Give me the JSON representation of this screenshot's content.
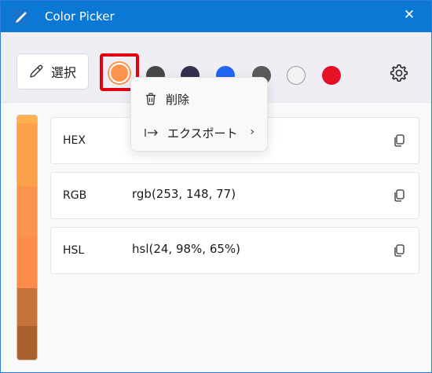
{
  "window": {
    "title": "Color Picker",
    "close_glyph": "✕"
  },
  "toolbar": {
    "select_label": "選択",
    "selected_color": "#fd944d",
    "swatches": [
      "#474747",
      "#34304d",
      "#2265f5",
      "#5a5a5a",
      "#f3f3f3",
      "#e61123"
    ]
  },
  "context_menu": {
    "delete_label": "削除",
    "export_label": "エクスポート",
    "export_arrow": "›"
  },
  "color_values": [
    {
      "key": "HEX",
      "value": ""
    },
    {
      "key": "RGB",
      "value": "rgb(253, 148, 77)"
    },
    {
      "key": "HSL",
      "value": "hsl(24, 98%, 65%)"
    }
  ],
  "strip_colors": [
    "#fdb04d",
    "#fda04a",
    "#fd944d",
    "#fd8d4a",
    "#c5733b",
    "#a8612f"
  ]
}
